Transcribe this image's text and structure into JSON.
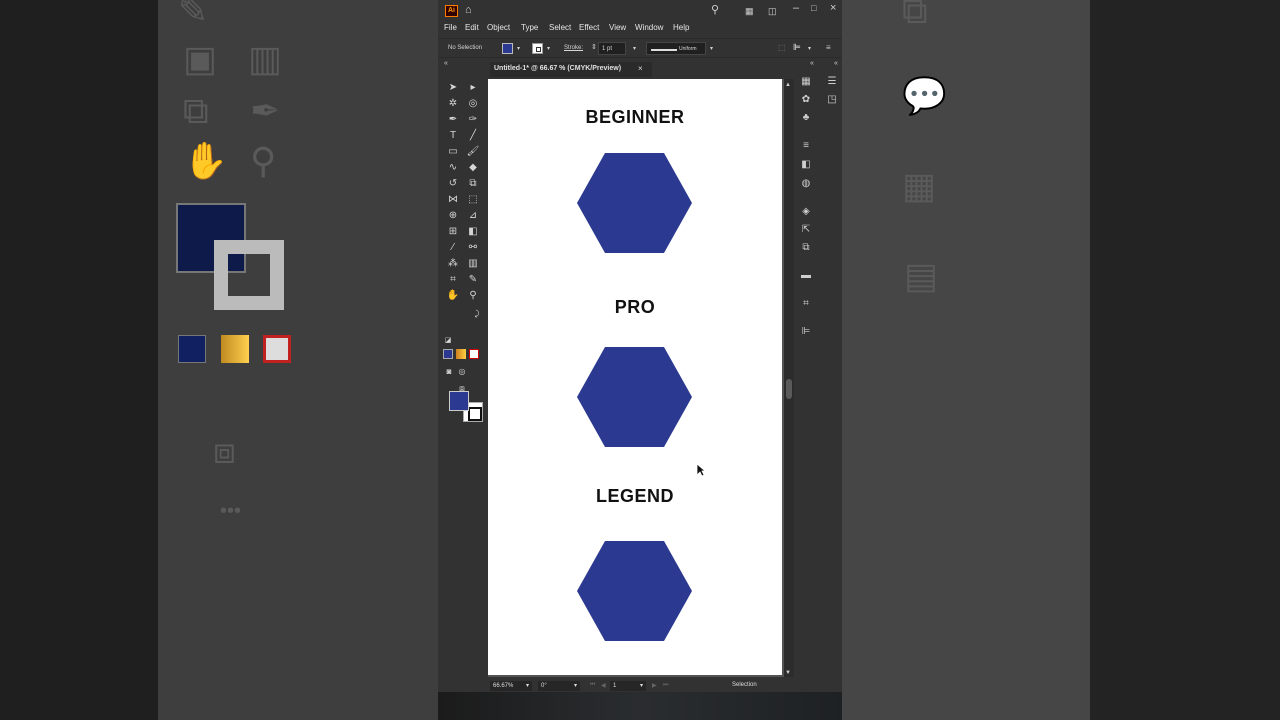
{
  "menus": [
    "File",
    "Edit",
    "Object",
    "Type",
    "Select",
    "Effect",
    "View",
    "Window",
    "Help"
  ],
  "control": {
    "selection": "No Selection",
    "stroke_label": "Stroke:",
    "stroke_weight": "1 pt",
    "profile": "Uniform"
  },
  "document": {
    "tab_title": "Untitled-1* @ 66.67 % (CMYK/Preview)",
    "close": "×"
  },
  "artboard": {
    "levels": [
      "BEGINNER",
      "PRO",
      "LEGEND"
    ],
    "hexagon_color": "#2b3990"
  },
  "status": {
    "zoom": "66.67%",
    "rotation": "0°",
    "artboard_number": "1",
    "tool": "Selection"
  },
  "colors": {
    "fill": "#2b3990",
    "app_bg": "#323232"
  }
}
